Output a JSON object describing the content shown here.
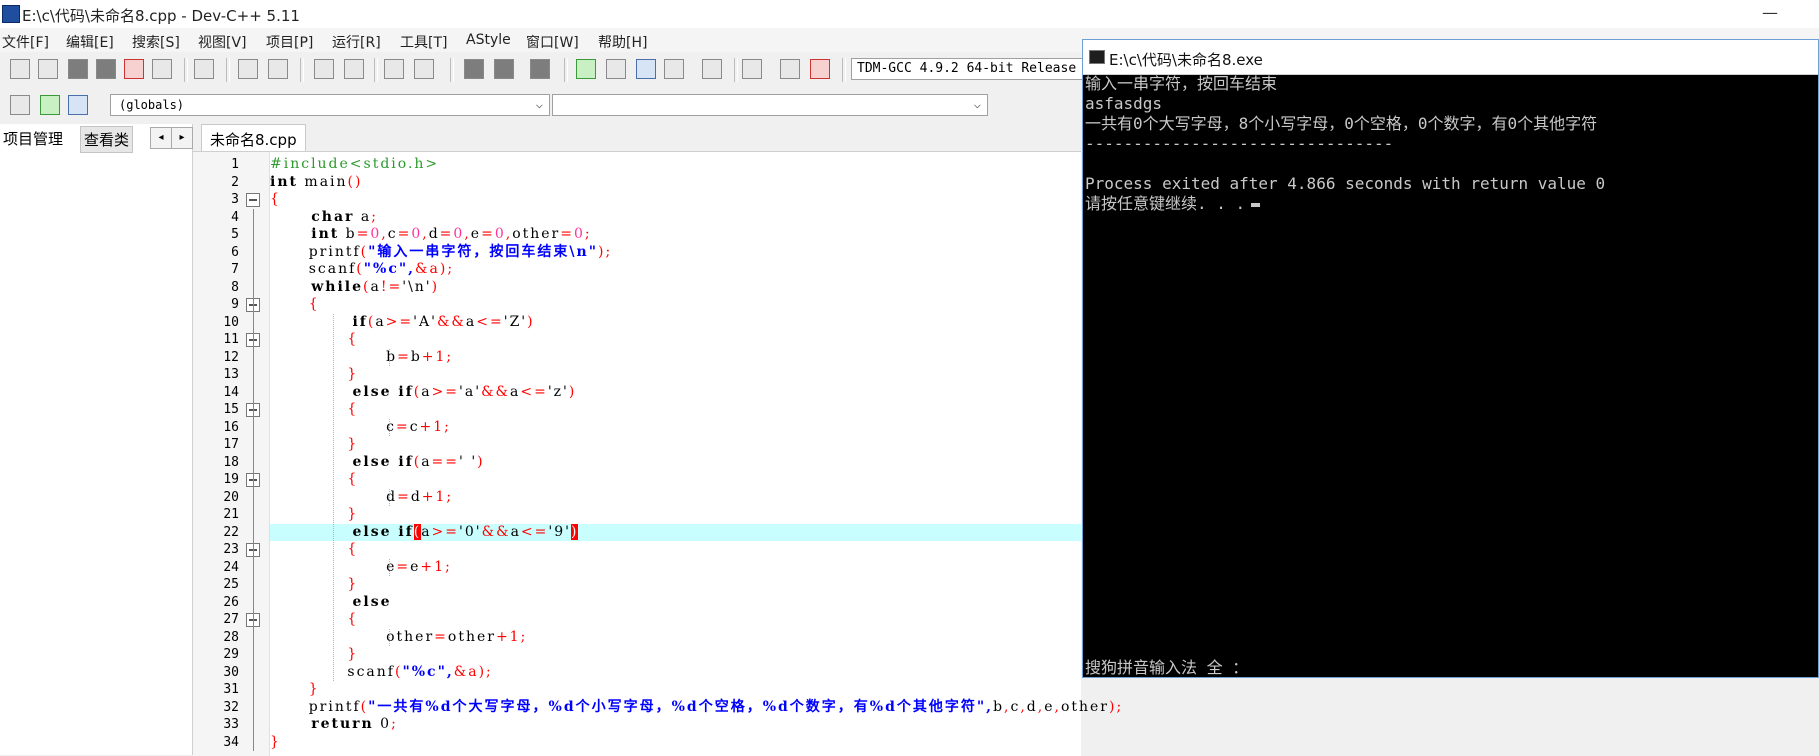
{
  "window": {
    "title": "E:\\c\\代码\\未命名8.cpp - Dev-C++ 5.11",
    "minimize": "—"
  },
  "menu": [
    "文件[F]",
    "编辑[E]",
    "搜索[S]",
    "视图[V]",
    "项目[P]",
    "运行[R]",
    "工具[T]",
    "AStyle",
    "窗口[W]",
    "帮助[H]"
  ],
  "toolbar": {
    "compiler": "TDM-GCC 4.9.2 64-bit Release"
  },
  "toolbar2": {
    "scope_combo": "(globals)",
    "func_combo": ""
  },
  "left_panel": {
    "tabs": [
      "项目管理",
      "查看类"
    ],
    "nav_prev": "◂",
    "nav_next": "▸"
  },
  "editor": {
    "tab": "未命名8.cpp",
    "line_numbers": [
      "1",
      "2",
      "3",
      "4",
      "5",
      "6",
      "7",
      "8",
      "9",
      "10",
      "11",
      "12",
      "13",
      "14",
      "15",
      "16",
      "17",
      "18",
      "19",
      "20",
      "21",
      "22",
      "23",
      "24",
      "25",
      "26",
      "27",
      "28",
      "29",
      "30",
      "31",
      "32",
      "33",
      "34"
    ],
    "lines": [
      [
        {
          "t": "#include<stdio.h>",
          "c": "pp"
        }
      ],
      [
        {
          "t": "int",
          "c": "kw"
        },
        {
          "t": " main",
          "c": "txt"
        },
        {
          "t": "()",
          "c": "op"
        }
      ],
      [
        {
          "t": "{",
          "c": "op"
        }
      ],
      [
        {
          "t": "      char",
          "c": "kw"
        },
        {
          "t": " a",
          "c": "txt"
        },
        {
          "t": ";",
          "c": "op"
        }
      ],
      [
        {
          "t": "      int",
          "c": "kw"
        },
        {
          "t": " b",
          "c": "txt"
        },
        {
          "t": "=",
          "c": "op"
        },
        {
          "t": "0",
          "c": "num"
        },
        {
          "t": ",",
          "c": "op"
        },
        {
          "t": "c",
          "c": "txt"
        },
        {
          "t": "=",
          "c": "op"
        },
        {
          "t": "0",
          "c": "num"
        },
        {
          "t": ",",
          "c": "op"
        },
        {
          "t": "d",
          "c": "txt"
        },
        {
          "t": "=",
          "c": "op"
        },
        {
          "t": "0",
          "c": "num"
        },
        {
          "t": ",",
          "c": "op"
        },
        {
          "t": "e",
          "c": "txt"
        },
        {
          "t": "=",
          "c": "op"
        },
        {
          "t": "0",
          "c": "num"
        },
        {
          "t": ",",
          "c": "op"
        },
        {
          "t": "other",
          "c": "txt"
        },
        {
          "t": "=",
          "c": "op"
        },
        {
          "t": "0",
          "c": "num"
        },
        {
          "t": ";",
          "c": "op"
        }
      ],
      [
        {
          "t": "      printf",
          "c": "txt"
        },
        {
          "t": "(",
          "c": "op"
        },
        {
          "t": "\"输入一串字符，按回车结束\\n\"",
          "c": "str"
        },
        {
          "t": ");",
          "c": "op"
        }
      ],
      [
        {
          "t": "      scanf",
          "c": "txt"
        },
        {
          "t": "(",
          "c": "op"
        },
        {
          "t": "\"%c\",",
          "c": "str"
        },
        {
          "t": "&a",
          "c": "op"
        },
        {
          "t": ");",
          "c": "op"
        }
      ],
      [
        {
          "t": "      while",
          "c": "kw"
        },
        {
          "t": "(",
          "c": "op"
        },
        {
          "t": "a",
          "c": "txt"
        },
        {
          "t": "!=",
          "c": "op"
        },
        {
          "t": "'\\n'",
          "c": "ch"
        },
        {
          "t": ")",
          "c": "op"
        }
      ],
      [
        {
          "t": "      {",
          "c": "op"
        }
      ],
      [
        {
          "t": "            if",
          "c": "kw"
        },
        {
          "t": "(",
          "c": "op"
        },
        {
          "t": "a",
          "c": "txt"
        },
        {
          "t": ">=",
          "c": "op"
        },
        {
          "t": "'A'",
          "c": "ch"
        },
        {
          "t": "&&",
          "c": "op"
        },
        {
          "t": "a",
          "c": "txt"
        },
        {
          "t": "<=",
          "c": "op"
        },
        {
          "t": "'Z'",
          "c": "ch"
        },
        {
          "t": ")",
          "c": "op"
        }
      ],
      [
        {
          "t": "            {",
          "c": "op"
        }
      ],
      [
        {
          "t": "                  b",
          "c": "txt"
        },
        {
          "t": "=",
          "c": "op"
        },
        {
          "t": "b",
          "c": "txt"
        },
        {
          "t": "+1",
          "c": "op"
        },
        {
          "t": ";",
          "c": "op"
        }
      ],
      [
        {
          "t": "            }",
          "c": "op"
        }
      ],
      [
        {
          "t": "            else if",
          "c": "kw"
        },
        {
          "t": "(",
          "c": "op"
        },
        {
          "t": "a",
          "c": "txt"
        },
        {
          "t": ">=",
          "c": "op"
        },
        {
          "t": "'a'",
          "c": "ch"
        },
        {
          "t": "&&",
          "c": "op"
        },
        {
          "t": "a",
          "c": "txt"
        },
        {
          "t": "<=",
          "c": "op"
        },
        {
          "t": "'z'",
          "c": "ch"
        },
        {
          "t": ")",
          "c": "op"
        }
      ],
      [
        {
          "t": "            {",
          "c": "op"
        }
      ],
      [
        {
          "t": "                  c",
          "c": "txt"
        },
        {
          "t": "=",
          "c": "op"
        },
        {
          "t": "c",
          "c": "txt"
        },
        {
          "t": "+1",
          "c": "op"
        },
        {
          "t": ";",
          "c": "op"
        }
      ],
      [
        {
          "t": "            }",
          "c": "op"
        }
      ],
      [
        {
          "t": "            else if",
          "c": "kw"
        },
        {
          "t": "(",
          "c": "op"
        },
        {
          "t": "a",
          "c": "txt"
        },
        {
          "t": "==",
          "c": "op"
        },
        {
          "t": "' '",
          "c": "ch"
        },
        {
          "t": ")",
          "c": "op"
        }
      ],
      [
        {
          "t": "            {",
          "c": "op"
        }
      ],
      [
        {
          "t": "                  d",
          "c": "txt"
        },
        {
          "t": "=",
          "c": "op"
        },
        {
          "t": "d",
          "c": "txt"
        },
        {
          "t": "+1",
          "c": "op"
        },
        {
          "t": ";",
          "c": "op"
        }
      ],
      [
        {
          "t": "            }",
          "c": "op"
        }
      ],
      [
        {
          "t": "            else if",
          "c": "kw"
        },
        {
          "t": "(",
          "c": "bracehl"
        },
        {
          "t": "a",
          "c": "txt"
        },
        {
          "t": ">=",
          "c": "op"
        },
        {
          "t": "'0'",
          "c": "ch"
        },
        {
          "t": "&&",
          "c": "op"
        },
        {
          "t": "a",
          "c": "txt"
        },
        {
          "t": "<=",
          "c": "op"
        },
        {
          "t": "'9'",
          "c": "ch"
        },
        {
          "t": ")",
          "c": "bracehl"
        }
      ],
      [
        {
          "t": "            {",
          "c": "op"
        }
      ],
      [
        {
          "t": "                  e",
          "c": "txt"
        },
        {
          "t": "=",
          "c": "op"
        },
        {
          "t": "e",
          "c": "txt"
        },
        {
          "t": "+1",
          "c": "op"
        },
        {
          "t": ";",
          "c": "op"
        }
      ],
      [
        {
          "t": "            }",
          "c": "op"
        }
      ],
      [
        {
          "t": "            else",
          "c": "kw"
        }
      ],
      [
        {
          "t": "            {",
          "c": "op"
        }
      ],
      [
        {
          "t": "                  other",
          "c": "txt"
        },
        {
          "t": "=",
          "c": "op"
        },
        {
          "t": "other",
          "c": "txt"
        },
        {
          "t": "+1",
          "c": "op"
        },
        {
          "t": ";",
          "c": "op"
        }
      ],
      [
        {
          "t": "            }",
          "c": "op"
        }
      ],
      [
        {
          "t": "            scanf",
          "c": "txt"
        },
        {
          "t": "(",
          "c": "op"
        },
        {
          "t": "\"%c\",",
          "c": "str"
        },
        {
          "t": "&a",
          "c": "op"
        },
        {
          "t": ");",
          "c": "op"
        }
      ],
      [
        {
          "t": "      }",
          "c": "op"
        }
      ],
      [
        {
          "t": "      printf",
          "c": "txt"
        },
        {
          "t": "(",
          "c": "op"
        },
        {
          "t": "\"一共有%d个大写字母，%d个小写字母，%d个空格，%d个数字，有%d个其他字符\",",
          "c": "str"
        },
        {
          "t": "b",
          "c": "txt"
        },
        {
          "t": ",",
          "c": "op"
        },
        {
          "t": "c",
          "c": "txt"
        },
        {
          "t": ",",
          "c": "op"
        },
        {
          "t": "d",
          "c": "txt"
        },
        {
          "t": ",",
          "c": "op"
        },
        {
          "t": "e",
          "c": "txt"
        },
        {
          "t": ",",
          "c": "op"
        },
        {
          "t": "other",
          "c": "txt"
        },
        {
          "t": ");",
          "c": "op"
        }
      ],
      [
        {
          "t": "      return",
          "c": "kw"
        },
        {
          "t": " 0",
          "c": "txt"
        },
        {
          "t": ";",
          "c": "op"
        }
      ],
      [
        {
          "t": "}",
          "c": "op"
        }
      ]
    ]
  },
  "console": {
    "title": "E:\\c\\代码\\未命名8.exe",
    "lines": [
      "输入一串字符，按回车结束",
      "asfasdgs",
      "一共有0个大写字母，8个小写字母，0个空格，0个数字，有0个其他字符",
      "--------------------------------",
      "",
      "Process exited after 4.866 seconds with return value 0",
      "请按任意键继续. . ."
    ],
    "ime": "搜狗拼音输入法 全 ："
  },
  "colors": {
    "highlight_line": "#c8fffe",
    "console_bg": "#000000",
    "keyword": "#000000",
    "operator": "#ff0000",
    "string": "#0000ff",
    "preprocessor": "#2c9a2c"
  }
}
